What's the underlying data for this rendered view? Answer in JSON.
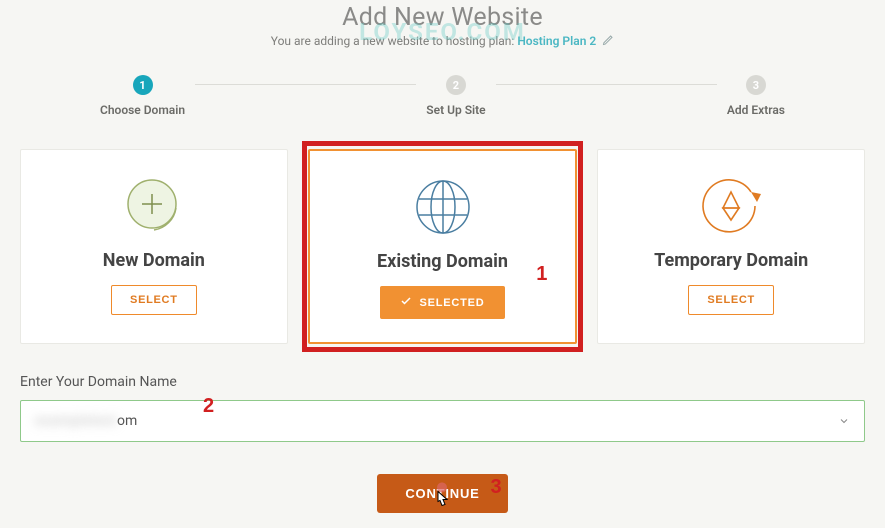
{
  "page": {
    "title": "Add New Website",
    "sub_prefix": "You are adding a new website to hosting plan: ",
    "plan_link": "Hosting Plan 2",
    "watermark": "LOYSEO.COM"
  },
  "steps": {
    "items": [
      {
        "num": "1",
        "label": "Choose Domain",
        "active": true
      },
      {
        "num": "2",
        "label": "Set Up Site",
        "active": false
      },
      {
        "num": "3",
        "label": "Add Extras",
        "active": false
      }
    ]
  },
  "cards": {
    "new": {
      "title": "New Domain",
      "button": "SELECT"
    },
    "existing": {
      "title": "Existing Domain",
      "button": "SELECTED"
    },
    "temporary": {
      "title": "Temporary Domain",
      "button": "SELECT"
    }
  },
  "domain": {
    "label": "Enter Your Domain Name",
    "value_blurred": "exampletext",
    "value_suffix": "om"
  },
  "continue_label": "CONTINUE",
  "annotations": {
    "n1": "1",
    "n2": "2",
    "n3": "3"
  },
  "colors": {
    "accent": "#f19132",
    "step_active": "#18a6bb",
    "danger": "#d12020",
    "continue": "#c65a17",
    "link": "#4bb7c3",
    "input_border": "#8fc98a"
  }
}
